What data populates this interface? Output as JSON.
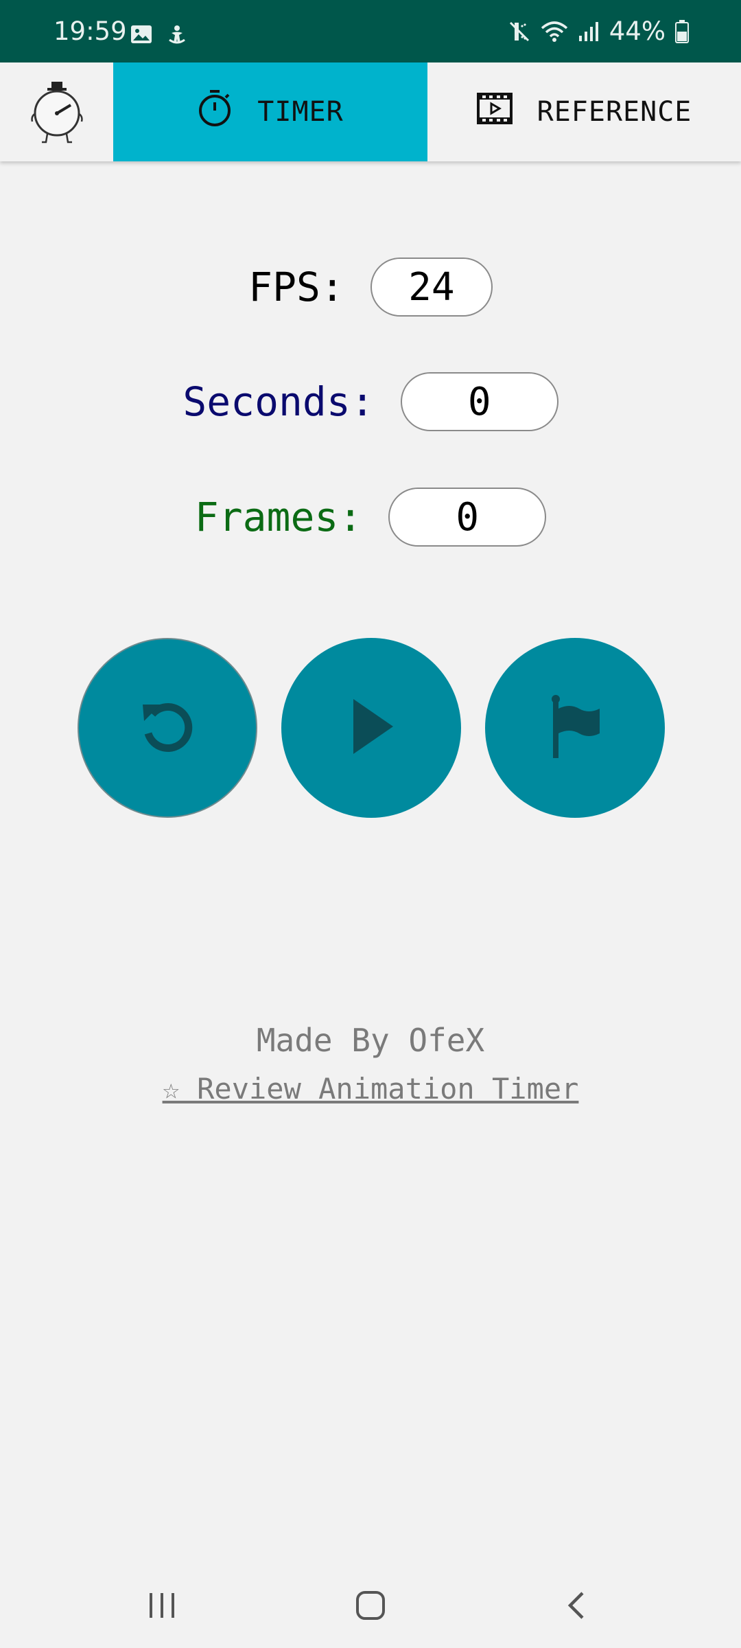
{
  "status_bar": {
    "time": "19:59",
    "battery": "44%",
    "icons": [
      "image-icon",
      "accessibility-icon",
      "mute-icon",
      "wifi-icon",
      "signal-icon",
      "battery-icon"
    ]
  },
  "tabs": [
    {
      "label": "TIMER",
      "icon": "stopwatch-icon",
      "active": true
    },
    {
      "label": "REFERENCE",
      "icon": "film-play-icon",
      "active": false
    }
  ],
  "fields": {
    "fps": {
      "label": "FPS:",
      "value": "24"
    },
    "seconds": {
      "label": "Seconds:",
      "value": "0"
    },
    "frames": {
      "label": "Frames:",
      "value": "0"
    }
  },
  "controls": {
    "reset_icon": "reset-icon",
    "play_icon": "play-icon",
    "flag_icon": "flag-icon"
  },
  "footer": {
    "made_by": "Made By OfeX",
    "review_link": "☆ Review Animation Timer"
  },
  "colors": {
    "status_bar": "#00574b",
    "active_tab": "#00b3cc",
    "button": "#008a9e",
    "button_icon": "#0b4d57",
    "fps_label": "#000000",
    "seconds_label": "#0a0a6e",
    "frames_label": "#0b6b14",
    "footer_text": "#7a7a7a"
  }
}
